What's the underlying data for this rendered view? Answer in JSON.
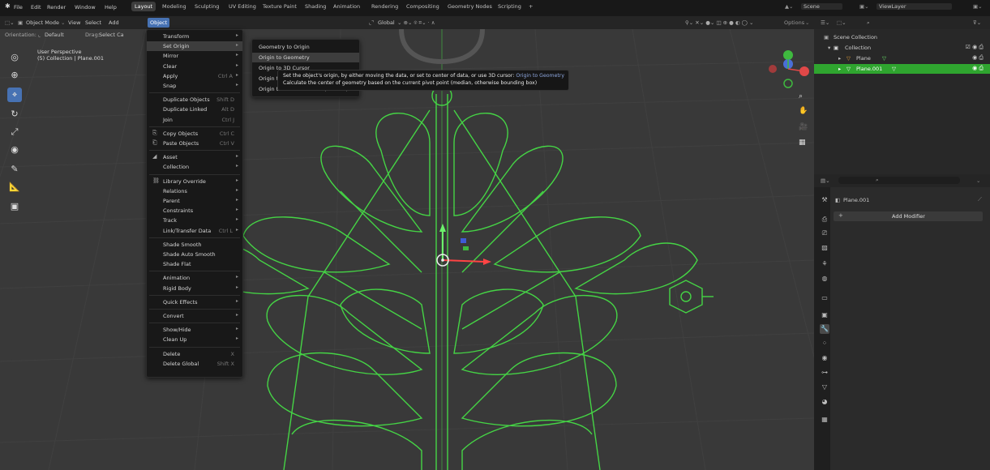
{
  "topbar": {
    "menus": [
      "File",
      "Edit",
      "Render",
      "Window",
      "Help"
    ],
    "workspaces": [
      "Layout",
      "Modeling",
      "Sculpting",
      "UV Editing",
      "Texture Paint",
      "Shading",
      "Animation",
      "Rendering",
      "Compositing",
      "Geometry Nodes",
      "Scripting",
      "+"
    ],
    "active_workspace": "Layout",
    "scene_label": "Scene",
    "view_layer_label": "ViewLayer"
  },
  "header": {
    "mode": "Object Mode",
    "menus": [
      "View",
      "Select",
      "Add",
      "Object"
    ],
    "transform": "Global",
    "options": "Options"
  },
  "tool_settings": {
    "orientation_label": "Orientation:",
    "orientation_value": "Default",
    "drag_label": "Drag:",
    "drag_value": "Select Ca"
  },
  "viewport": {
    "perspective": "User Perspective",
    "collection_info": "(5) Collection | Plane.001"
  },
  "object_menu": {
    "items": [
      {
        "label": "Transform",
        "arrow": true
      },
      {
        "label": "Set Origin",
        "arrow": true,
        "highlighted": true
      },
      {
        "label": "Mirror",
        "arrow": true
      },
      {
        "label": "Clear",
        "arrow": true
      },
      {
        "label": "Apply",
        "shortcut": "Ctrl A",
        "arrow": true
      },
      {
        "label": "Snap",
        "arrow": true
      },
      {
        "sep": true
      },
      {
        "label": "Duplicate Objects",
        "shortcut": "Shift D"
      },
      {
        "label": "Duplicate Linked",
        "shortcut": "Alt D"
      },
      {
        "label": "Join",
        "shortcut": "Ctrl J"
      },
      {
        "sep": true
      },
      {
        "label": "Copy Objects",
        "shortcut": "Ctrl C",
        "icon": "copy-icon"
      },
      {
        "label": "Paste Objects",
        "shortcut": "Ctrl V",
        "icon": "paste-icon"
      },
      {
        "sep": true
      },
      {
        "label": "Asset",
        "arrow": true,
        "icon": "asset-icon"
      },
      {
        "label": "Collection",
        "arrow": true
      },
      {
        "sep": true
      },
      {
        "label": "Library Override",
        "arrow": true,
        "icon": "library-icon"
      },
      {
        "label": "Relations",
        "arrow": true
      },
      {
        "label": "Parent",
        "arrow": true
      },
      {
        "label": "Constraints",
        "arrow": true
      },
      {
        "label": "Track",
        "arrow": true
      },
      {
        "label": "Link/Transfer Data",
        "shortcut": "Ctrl L",
        "arrow": true
      },
      {
        "sep": true
      },
      {
        "label": "Shade Smooth"
      },
      {
        "label": "Shade Auto Smooth"
      },
      {
        "label": "Shade Flat"
      },
      {
        "sep": true
      },
      {
        "label": "Animation",
        "arrow": true
      },
      {
        "label": "Rigid Body",
        "arrow": true
      },
      {
        "sep": true
      },
      {
        "label": "Quick Effects",
        "arrow": true
      },
      {
        "sep": true
      },
      {
        "label": "Convert",
        "arrow": true
      },
      {
        "sep": true
      },
      {
        "label": "Show/Hide",
        "arrow": true
      },
      {
        "label": "Clean Up",
        "arrow": true
      },
      {
        "sep": true
      },
      {
        "label": "Delete",
        "shortcut": "X"
      },
      {
        "label": "Delete Global",
        "shortcut": "Shift X"
      }
    ]
  },
  "set_origin_menu": {
    "items": [
      "Geometry to Origin",
      "Origin to Geometry",
      "Origin to 3D Cursor",
      "Origin to Center of Mass (Surface)",
      "Origin to Center of Mass (Volume)"
    ],
    "highlighted": "Origin to Geometry"
  },
  "tooltip": {
    "line1": "Set the object's origin, by either moving the data, or set to center of data, or use 3D cursor:",
    "line1_value": "Origin to Geometry",
    "line2": "Calculate the center of geometry based on the current pivot point (median, otherwise bounding box)"
  },
  "outliner": {
    "root": "Scene Collection",
    "collection": "Collection",
    "objects": [
      "Plane",
      "Plane.001"
    ],
    "selected": "Plane.001"
  },
  "properties": {
    "object_name": "Plane.001",
    "add_modifier": "Add Modifier"
  },
  "colors": {
    "accent": "#4772b3",
    "selection_green": "#3fb93f",
    "mesh_green": "#45d445"
  }
}
